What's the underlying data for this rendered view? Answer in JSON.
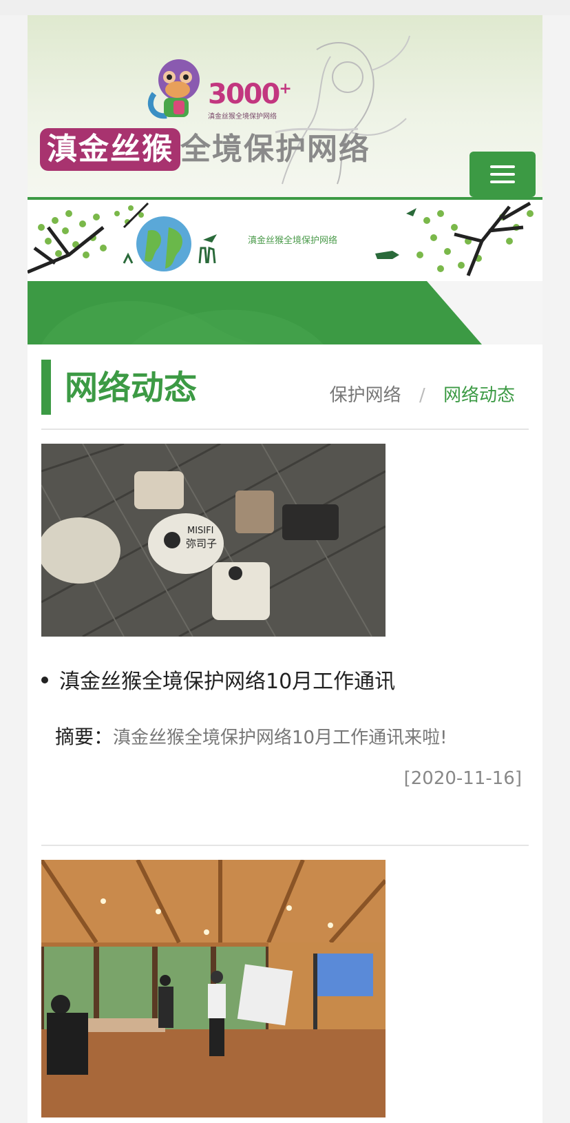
{
  "header": {
    "logo_number": "3000",
    "logo_plus": "+",
    "logo_caption": "滇金丝猴全境保护网络",
    "title_highlight": "滇金丝猴",
    "title_rest": "全境保护网络"
  },
  "banner": {
    "caption": "滇金丝猴全境保护网络"
  },
  "section": {
    "title": "网络动态",
    "breadcrumb": [
      "保护网络",
      "网络动态"
    ],
    "breadcrumb_sep": "/"
  },
  "news": [
    {
      "title": "滇金丝猴全境保护网络10月工作通讯",
      "summary_label": "摘要：",
      "summary": "滇金丝猴全境保护网络10月工作通讯来啦!",
      "date": "[2020-11-16]",
      "thumb_marks": [
        "MISIFI",
        "弥司子"
      ]
    },
    {
      "title": "",
      "summary_label": "",
      "summary": "",
      "date": ""
    }
  ],
  "colors": {
    "accent": "#3c9a44",
    "brand_magenta": "#a8336f",
    "text_muted": "#777777"
  },
  "icons": [
    "hamburger-menu-icon",
    "bullet-dot-icon"
  ]
}
